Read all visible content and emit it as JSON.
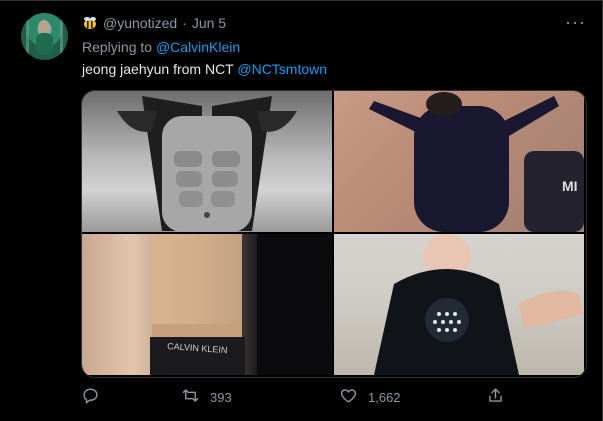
{
  "tweet": {
    "author_handle": "@yunotized",
    "separator": "·",
    "date": "Jun 5",
    "replying_prefix": "Replying to",
    "replying_to": "@CalvinKlein",
    "text": "jeong jaehyun from NCT",
    "text_mention": "@NCTsmtown",
    "more_label": "···"
  },
  "media": {
    "photos": [
      {
        "alt_icon": "photo-1"
      },
      {
        "alt_icon": "photo-2"
      },
      {
        "alt_icon": "photo-3"
      },
      {
        "alt_icon": "photo-4"
      }
    ]
  },
  "actions": {
    "reply_count": "",
    "retweet_count": "393",
    "like_count": "1,662",
    "share_label": ""
  },
  "colors": {
    "background": "#000000",
    "accent": "#1d9bf0",
    "muted": "#8b98a5",
    "text": "#e7e9ea"
  },
  "icons": {
    "reply": "reply-icon",
    "retweet": "retweet-icon",
    "like": "heart-icon",
    "share": "share-icon",
    "emoji": "bee-icon"
  }
}
